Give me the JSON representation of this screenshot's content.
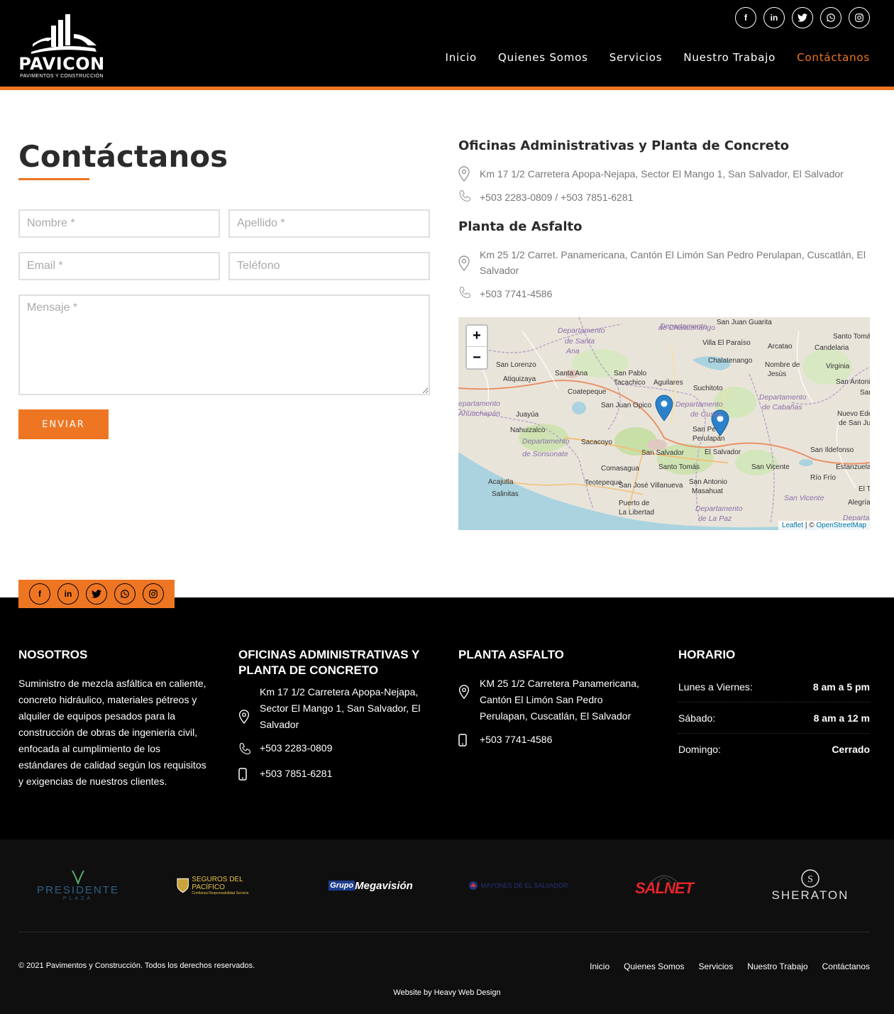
{
  "header": {
    "logo_text": "PAVICON",
    "logo_sub": "PAVIMENTOS Y CONSTRUCCIÓN",
    "social": [
      "facebook-icon",
      "linkedin-icon",
      "twitter-icon",
      "whatsapp-icon",
      "instagram-icon"
    ],
    "nav": [
      {
        "label": "Inicio"
      },
      {
        "label": "Quienes Somos"
      },
      {
        "label": "Servicios"
      },
      {
        "label": "Nuestro Trabajo"
      },
      {
        "label": "Contáctanos"
      }
    ],
    "active_color": "#ee7623"
  },
  "contact": {
    "title": "Contáctanos",
    "form": {
      "nombre_placeholder": "Nombre *",
      "apellido_placeholder": "Apellido *",
      "email_placeholder": "Email *",
      "telefono_placeholder": "Teléfono",
      "mensaje_placeholder": "Mensaje *",
      "submit_label": "ENVIAR"
    },
    "offices": [
      {
        "heading": "Oficinas Administrativas y Planta de Concreto",
        "address": "Km 17 1/2 Carretera Apopa-Nejapa, Sector El Mango 1, San Salvador, El Salvador",
        "phone": "+503 2283-0809 / +503 7851-6281"
      },
      {
        "heading": "Planta de Asfalto",
        "address": "Km 25 1/2 Carret. Panamericana, Cantón El Limón San Pedro Perulapan, Cuscatlán, El Salvador",
        "phone": "+503 7741-4586"
      }
    ],
    "map": {
      "zoom_in": "+",
      "zoom_out": "−",
      "attribution_leaflet": "Leaflet",
      "attribution_sep": " | © ",
      "attribution_osm": "OpenStreetMap",
      "labels": [
        {
          "t": "Departamento",
          "it": true
        },
        {
          "t": "de Santa",
          "it": true
        },
        {
          "t": "Ana",
          "it": true
        },
        {
          "t": "Departamento",
          "it": true
        },
        {
          "t": "de Chalatenango",
          "it": true
        },
        {
          "t": "San Juan Guarita"
        },
        {
          "t": "Santo Tomás"
        },
        {
          "t": "Villa El Paraíso"
        },
        {
          "t": "Arcatao"
        },
        {
          "t": "Candelaria"
        },
        {
          "t": "Chalatenango"
        },
        {
          "t": "San Lorenzo"
        },
        {
          "t": "Santa Ana"
        },
        {
          "t": "San Pablo"
        },
        {
          "t": "Tacachico"
        },
        {
          "t": "Aguilares"
        },
        {
          "t": "Nombre de"
        },
        {
          "t": "Jesús"
        },
        {
          "t": "Virginia"
        },
        {
          "t": "Atiquizaya"
        },
        {
          "t": "Coatepeque"
        },
        {
          "t": "Suchitoto"
        },
        {
          "t": "San Antonio"
        },
        {
          "t": "San"
        },
        {
          "t": "Departamento",
          "it": true
        },
        {
          "t": "de Cabañas",
          "it": true
        },
        {
          "t": "epartamento",
          "it": true
        },
        {
          "t": "Ahuachapán",
          "it": true
        },
        {
          "t": "Juayúa"
        },
        {
          "t": "San Juan Opico"
        },
        {
          "t": "Departamento",
          "it": true
        },
        {
          "t": "de Cusca",
          "it": true
        },
        {
          "t": "Nuevo Edén"
        },
        {
          "t": "de San Juan"
        },
        {
          "t": "Nahuizalco"
        },
        {
          "t": "San Pe"
        },
        {
          "t": "Perulapán"
        },
        {
          "t": "Departamento",
          "it": true
        },
        {
          "t": "de Sonsonate",
          "it": true
        },
        {
          "t": "Sacacoyo"
        },
        {
          "t": "San Salvador"
        },
        {
          "t": "El Salvador"
        },
        {
          "t": "San Ildefonso"
        },
        {
          "t": "Comasagua"
        },
        {
          "t": "Santo Tomás"
        },
        {
          "t": "San Vicente"
        },
        {
          "t": "Estanzuela"
        },
        {
          "t": "Río Frío"
        },
        {
          "t": "Acajutla"
        },
        {
          "t": "Teotepeque"
        },
        {
          "t": "San José Villanueva"
        },
        {
          "t": "San Antonio"
        },
        {
          "t": "Masahuat"
        },
        {
          "t": "El Triu"
        },
        {
          "t": "Salinitas"
        },
        {
          "t": "San Vicente",
          "it": true
        },
        {
          "t": "Puerto de"
        },
        {
          "t": "La Libertad"
        },
        {
          "t": "Departamento",
          "it": true
        },
        {
          "t": "de La Paz",
          "it": true
        },
        {
          "t": "Alegría"
        },
        {
          "t": "Departamento",
          "it": true
        }
      ]
    }
  },
  "footer": {
    "social": [
      "facebook-icon",
      "linkedin-icon",
      "twitter-icon",
      "whatsapp-icon",
      "instagram-icon"
    ],
    "nosotros": {
      "heading": "NOSOTROS",
      "text": "Suministro de mezcla asfáltica en caliente, concreto hidráulico, materiales pétreos y alquiler de equipos pesados para la construcción de obras de ingenieria civil, enfocada al cumplimiento de los estándares de calidad según los requisitos y exigencias de nuestros clientes."
    },
    "oficinas": {
      "heading": "OFICINAS ADMINISTRATIVAS Y PLANTA DE CONCRETO",
      "address": "Km 17 1/2 Carretera Apopa-Nejapa, Sector El Mango 1, San Salvador, El Salvador",
      "phone": "+503 2283-0809",
      "mobile": "+503 7851-6281"
    },
    "planta": {
      "heading": "PLANTA ASFALTO",
      "address": "KM 25 1/2 Carretera Panamericana, Cantón El Limón San Pedro Perulapan, Cuscatlán, El Salvador",
      "mobile": "+503 7741-4586"
    },
    "horario": {
      "heading": "HORARIO",
      "rows": [
        {
          "day": "Lunes a Viernes:",
          "time": "8 am a 5 pm"
        },
        {
          "day": "Sábado:",
          "time": "8 am a 12 m"
        },
        {
          "day": "Domingo:",
          "time": "Cerrado"
        }
      ]
    }
  },
  "partners": [
    {
      "name": "PRESIDENTE",
      "sub": "PLAZA"
    },
    {
      "name": "SEGUROS DEL PACÍFICO",
      "sub": "Confianza Responsabilidad Servicio"
    },
    {
      "name_a": "Grupo",
      "name_b": "Megavisión"
    },
    {
      "name": "MAYONES DE EL SALVADOR"
    },
    {
      "name": "SALNET"
    },
    {
      "name": "SHERATON"
    }
  ],
  "bottom": {
    "copyright": "© 2021 Pavimentos y Construcción. Todos los derechos reservados.",
    "nav": [
      "Inicio",
      "Quienes Somos",
      "Servicios",
      "Nuestro Trabajo",
      "Contáctanos"
    ],
    "credit": "Website by Heavy Web Design"
  }
}
